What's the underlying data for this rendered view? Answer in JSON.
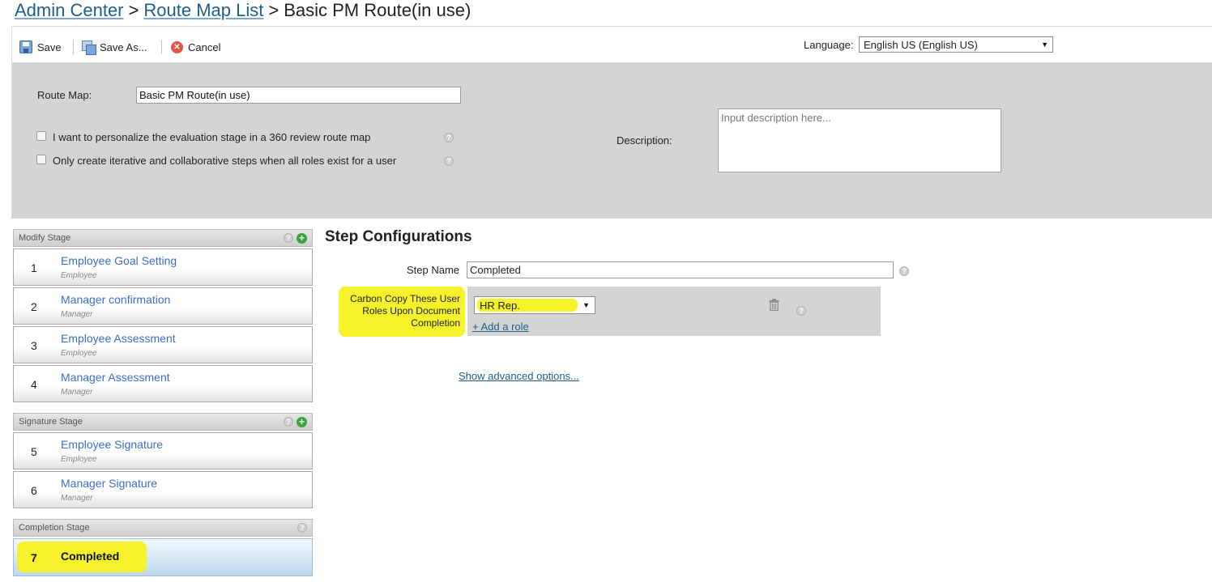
{
  "breadcrumb": {
    "items": [
      "Admin Center",
      "Route Map List"
    ],
    "separator": ">",
    "current": "Basic PM Route(in use)"
  },
  "toolbar": {
    "save_label": "Save",
    "save_as_label": "Save As...",
    "cancel_label": "Cancel",
    "language_label": "Language:",
    "language_value": "English US (English US)"
  },
  "header": {
    "route_map_label": "Route Map:",
    "route_map_value": "Basic PM Route(in use)",
    "checkbox_personalize": "I want to personalize the evaluation stage in a 360 review route map",
    "checkbox_iterative": "Only create iterative and collaborative steps when all roles exist for a user",
    "description_label": "Description:",
    "description_placeholder": "Input description here..."
  },
  "stages": [
    {
      "name": "Modify Stage",
      "steps": [
        {
          "num": "1",
          "title": "Employee Goal Setting",
          "role": "Employee"
        },
        {
          "num": "2",
          "title": "Manager confirmation",
          "role": "Manager"
        },
        {
          "num": "3",
          "title": "Employee Assessment",
          "role": "Employee"
        },
        {
          "num": "4",
          "title": "Manager Assessment",
          "role": "Manager"
        }
      ]
    },
    {
      "name": "Signature Stage",
      "steps": [
        {
          "num": "5",
          "title": "Employee Signature",
          "role": "Employee"
        },
        {
          "num": "6",
          "title": "Manager Signature",
          "role": "Manager"
        }
      ]
    },
    {
      "name": "Completion Stage",
      "steps": [
        {
          "num": "7",
          "title": "Completed",
          "role": ""
        }
      ]
    }
  ],
  "config": {
    "title": "Step Configurations",
    "step_name_label": "Step Name",
    "step_name_value": "Completed",
    "cc_label": "Carbon Copy These User Roles Upon Document Completion",
    "role_value": "HR Rep.",
    "add_role": "+ Add a role",
    "advanced": "Show advanced options..."
  },
  "colors": {
    "link": "#1e5f8a",
    "step_title": "#3d6ec9",
    "highlight": "#f5f22b",
    "panel_gray": "#d4d4d4"
  },
  "icons": [
    "save-icon",
    "save-as-icon",
    "cancel-icon",
    "help-icon",
    "add-icon",
    "trash-icon",
    "dropdown-caret-icon"
  ]
}
